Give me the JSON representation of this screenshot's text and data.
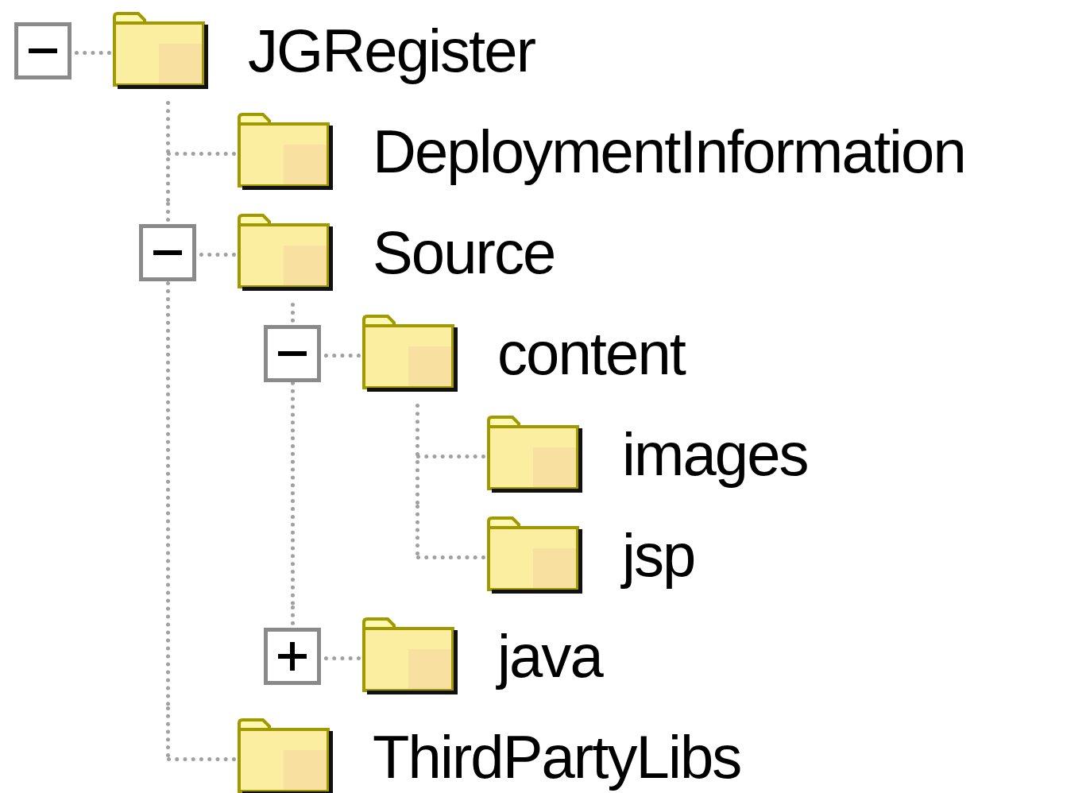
{
  "tree": [
    {
      "label": "JGRegister",
      "expanded": true,
      "children": [
        {
          "label": "DeploymentInformation"
        },
        {
          "label": "Source",
          "expanded": true,
          "children": [
            {
              "label": "content",
              "expanded": true,
              "children": [
                {
                  "label": "images"
                },
                {
                  "label": "jsp"
                }
              ]
            },
            {
              "label": "java",
              "expanded": false
            }
          ]
        },
        {
          "label": "ThirdPartyLibs"
        }
      ]
    }
  ]
}
